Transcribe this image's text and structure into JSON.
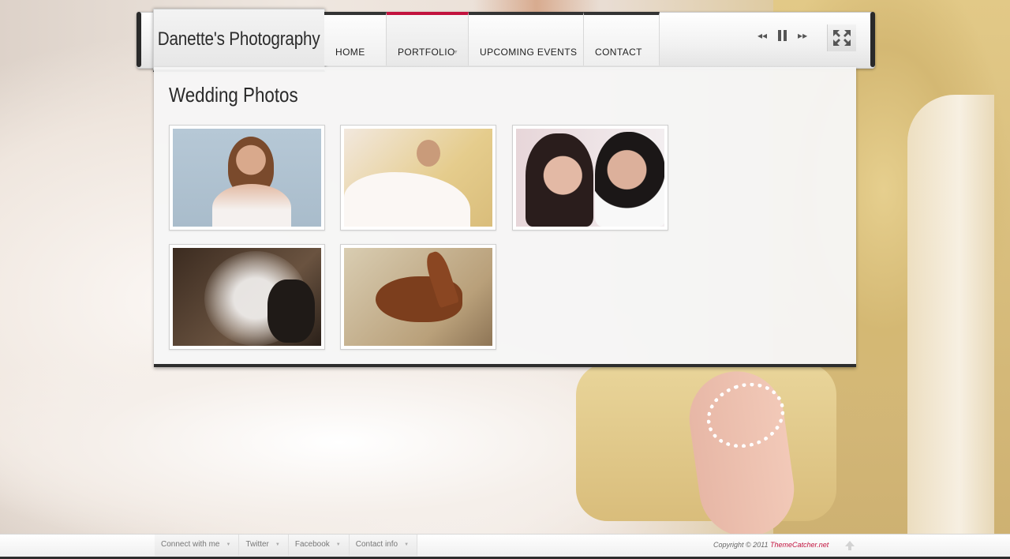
{
  "site": {
    "logo_text": "Danette's Photography"
  },
  "nav": {
    "items": [
      {
        "label": "HOME",
        "active": false,
        "has_submenu": false
      },
      {
        "label": "PORTFOLIO",
        "active": true,
        "has_submenu": true
      },
      {
        "label": "UPCOMING EVENTS",
        "active": false,
        "has_submenu": false
      },
      {
        "label": "CONTACT",
        "active": false,
        "has_submenu": false
      }
    ],
    "accent_color": "#c2123e"
  },
  "player": {
    "icons": [
      "rewind-icon",
      "pause-icon",
      "fast-forward-icon",
      "fullscreen-icon"
    ]
  },
  "main": {
    "title": "Wedding Photos",
    "gallery": [
      {
        "subject": "bride with veil portrait"
      },
      {
        "subject": "bride reclining on sofa"
      },
      {
        "subject": "couple embracing"
      },
      {
        "subject": "couple kissing under veil"
      },
      {
        "subject": "horses"
      }
    ]
  },
  "footer": {
    "links": [
      {
        "label": "Connect with me"
      },
      {
        "label": "Twitter"
      },
      {
        "label": "Facebook"
      },
      {
        "label": "Contact info"
      }
    ],
    "copyright_prefix": "Copyright © 2011",
    "copyright_brand": "ThemeCatcher.net"
  }
}
